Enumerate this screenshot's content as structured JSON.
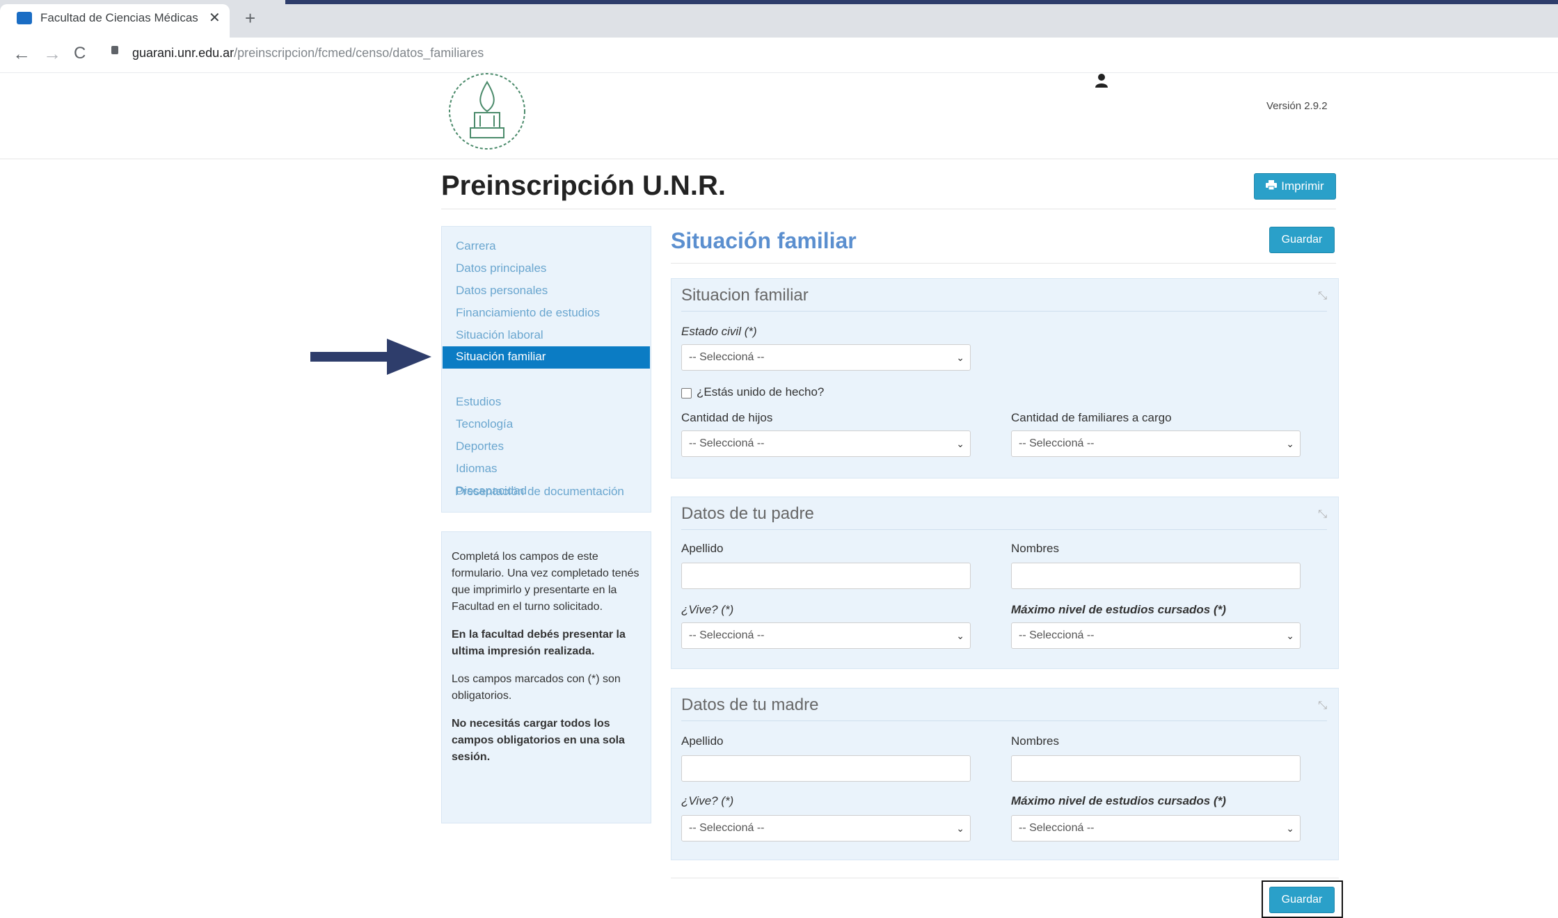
{
  "browser": {
    "tab_title": "Facultad de Ciencias Médicas - F",
    "tab_close": "✕",
    "new_tab": "+",
    "back": "←",
    "forward": "→",
    "reload": "C",
    "url_host": "guarani.unr.edu.ar",
    "url_path": "/preinscripcion/fcmed/censo/datos_familiares"
  },
  "header": {
    "version": "Versión 2.9.2"
  },
  "page": {
    "title": "Preinscripción U.N.R.",
    "print_label": "Imprimir"
  },
  "nav": {
    "items": [
      "Carrera",
      "Datos principales",
      "Datos personales",
      "Financiamiento de estudios",
      "Situación laboral",
      "Situación familiar",
      "Estudios",
      "Tecnología",
      "Deportes",
      "Idiomas",
      "Discapacidad",
      "Presentación de documentación"
    ],
    "active": "Situación familiar"
  },
  "help": {
    "p1": "Completá los campos de este formulario. Una vez completado tenés que imprimirlo y presentarte en la Facultad en el turno solicitado.",
    "p2": "En la facultad debés presentar la ultima impresión realizada.",
    "p3": "Los campos marcados con (*) son obligatorios.",
    "p4": "No necesitás cargar todos los campos obligatorios en una sola sesión."
  },
  "main": {
    "section_title": "Situación familiar",
    "save_label": "Guardar"
  },
  "placeholder_select": "-- Seleccioná --",
  "panel_situacion": {
    "title": "Situacion familiar",
    "estado_civil_label": "Estado civil (*)",
    "estado_civil_value": "-- Seleccioná --",
    "union_label": "¿Estás unido de hecho?",
    "hijos_label": "Cantidad de hijos",
    "hijos_value": "-- Seleccioná --",
    "familiares_label": "Cantidad de familiares a cargo",
    "familiares_value": "-- Seleccioná --"
  },
  "panel_padre": {
    "title": "Datos de tu padre",
    "apellido_label": "Apellido",
    "apellido_value": "",
    "nombres_label": "Nombres",
    "nombres_value": "",
    "vive_label": "¿Vive? (*)",
    "vive_value": "-- Seleccioná --",
    "estudios_label": "Máximo nivel de estudios cursados (*)",
    "estudios_value": "-- Seleccioná --"
  },
  "panel_madre": {
    "title": "Datos de tu madre",
    "apellido_label": "Apellido",
    "apellido_value": "",
    "nombres_label": "Nombres",
    "nombres_value": "",
    "vive_label": "¿Vive? (*)",
    "vive_value": "-- Seleccioná --",
    "estudios_label": "Máximo nivel de estudios cursados (*)",
    "estudios_value": "-- Seleccioná --"
  },
  "colors": {
    "accent": "#2aa0c9",
    "nav_active": "#0b7cc4",
    "section_title": "#5b8fcf",
    "panel_bg": "#eaf3fb",
    "annotation_arrow": "#2e3d6b"
  }
}
